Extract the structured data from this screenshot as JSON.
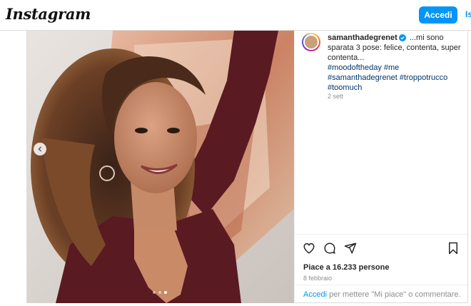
{
  "header": {
    "logo": "Instagram",
    "login_label": "Accedi",
    "signup_label": "Is"
  },
  "post": {
    "username": "samanthadegrenet",
    "verified_icon": "verified-badge-icon",
    "caption_text": "...mi sono sparata 3 pose: felice, contenta, super contenta...",
    "hashtags": [
      "#moodoftheday",
      "#me",
      "#samanthadegrenet",
      "#troppotrucco",
      "#toomuch"
    ],
    "caption_time": "2 sett",
    "likes": "Piace a 16.233 persone",
    "date": "8 febbraio",
    "login_prompt_link": "Accedi",
    "login_prompt_text": " per mettere \"Mi piace\" o commentare.",
    "carousel": {
      "slide_count": 3,
      "active_index": 2
    }
  },
  "icons": [
    "heart-icon",
    "comment-icon",
    "share-icon",
    "bookmark-icon",
    "chevron-left-icon"
  ],
  "colors": {
    "accent": "#0095f6",
    "hashtag": "#00376b",
    "muted": "#8e8e8e",
    "photo_dress": "#5a1a22"
  }
}
